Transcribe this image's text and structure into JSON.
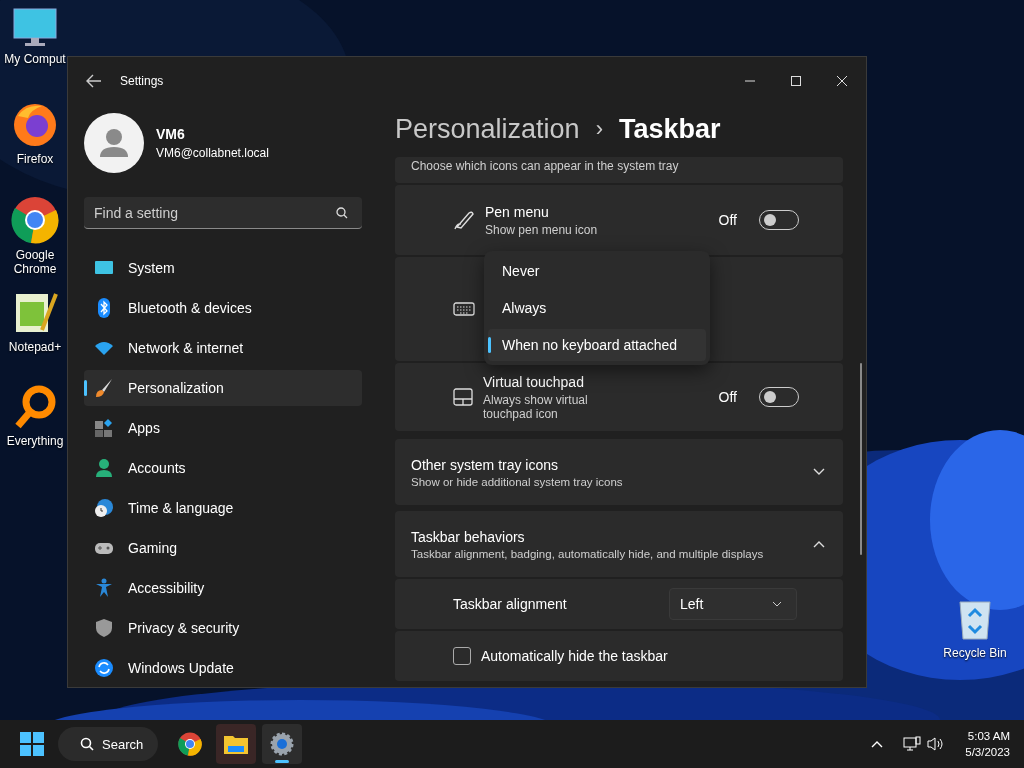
{
  "desktop_icons": [
    {
      "label": "My Comput",
      "kind": "computer"
    },
    {
      "label": "Firefox",
      "kind": "firefox"
    },
    {
      "label": "Google Chrome",
      "kind": "chrome"
    },
    {
      "label": "Notepad+",
      "kind": "notepad"
    },
    {
      "label": "Everything",
      "kind": "everything"
    }
  ],
  "recycle_bin": {
    "label": "Recycle Bin"
  },
  "window": {
    "title": "Settings",
    "user": {
      "name": "VM6",
      "email": "VM6@collabnet.local"
    },
    "search": {
      "placeholder": "Find a setting"
    },
    "nav": [
      {
        "label": "System",
        "kind": "system",
        "selected": false
      },
      {
        "label": "Bluetooth & devices",
        "kind": "bluetooth",
        "selected": false
      },
      {
        "label": "Network & internet",
        "kind": "network",
        "selected": false
      },
      {
        "label": "Personalization",
        "kind": "personalization",
        "selected": true
      },
      {
        "label": "Apps",
        "kind": "apps",
        "selected": false
      },
      {
        "label": "Accounts",
        "kind": "accounts",
        "selected": false
      },
      {
        "label": "Time & language",
        "kind": "time",
        "selected": false
      },
      {
        "label": "Gaming",
        "kind": "gaming",
        "selected": false
      },
      {
        "label": "Accessibility",
        "kind": "accessibility",
        "selected": false
      },
      {
        "label": "Privacy & security",
        "kind": "privacy",
        "selected": false
      },
      {
        "label": "Windows Update",
        "kind": "update",
        "selected": false
      }
    ],
    "breadcrumb": {
      "parent": "Personalization",
      "separator": "›",
      "current": "Taskbar"
    },
    "tray_header": {
      "description": "Choose which icons can appear in the system tray"
    },
    "tray_rows": [
      {
        "kind": "pen",
        "title": "Pen menu",
        "description": "Show pen menu icon",
        "state": "Off",
        "on": false
      },
      {
        "kind": "keyboard"
      },
      {
        "kind": "touchpad",
        "title": "Virtual touchpad",
        "description": "Always show virtual touchpad icon",
        "state": "Off",
        "on": false
      }
    ],
    "dropdown_menu": {
      "options": [
        {
          "label": "Never",
          "selected": false
        },
        {
          "label": "Always",
          "selected": false
        },
        {
          "label": "When no keyboard attached",
          "selected": true
        }
      ]
    },
    "sections": [
      {
        "title": "Other system tray icons",
        "description": "Show or hide additional system tray icons",
        "expanded": false
      },
      {
        "title": "Taskbar behaviors",
        "description": "Taskbar alignment, badging, automatically hide, and multiple displays",
        "expanded": true
      }
    ],
    "behaviors": {
      "alignment": {
        "label": "Taskbar alignment",
        "value": "Left"
      },
      "autohide": {
        "label": "Automatically hide the taskbar",
        "checked": false
      }
    }
  },
  "taskbar": {
    "search_label": "Search",
    "apps": [
      {
        "kind": "chrome",
        "active": false
      },
      {
        "kind": "explorer",
        "active": false
      },
      {
        "kind": "settings",
        "active": true
      }
    ],
    "time": "5:03 AM",
    "date": "5/3/2023"
  }
}
